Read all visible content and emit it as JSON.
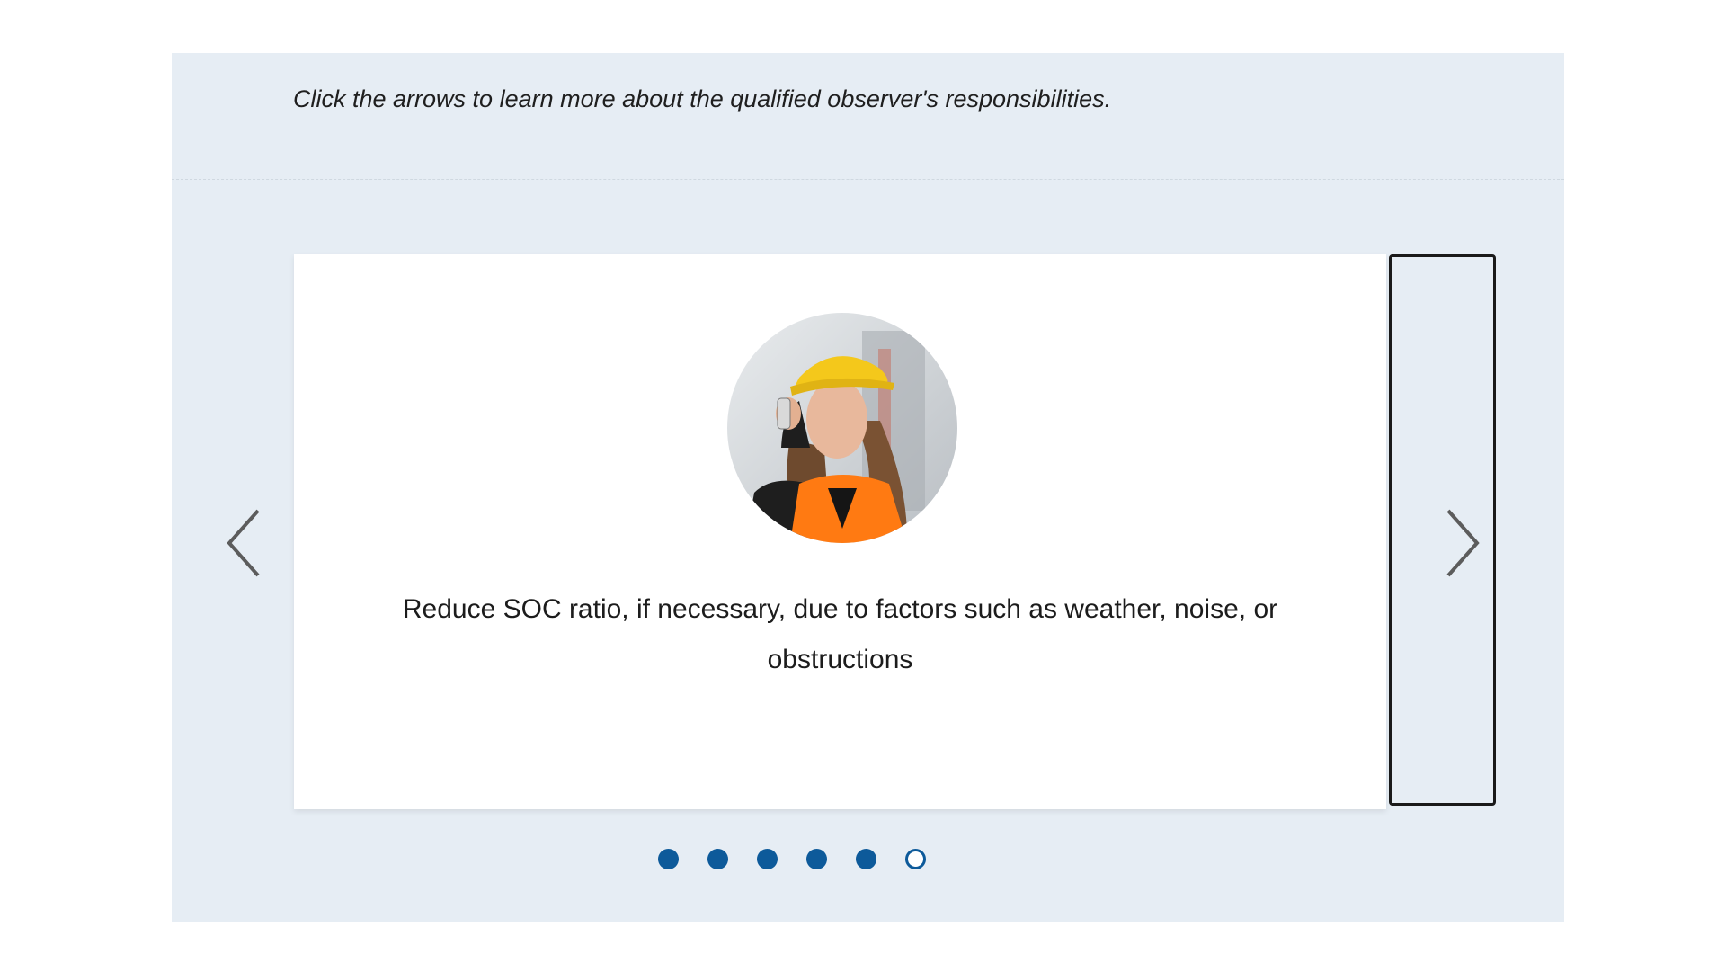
{
  "instruction": "Click the arrows to learn more about the qualified observer's responsibilities.",
  "slide": {
    "image": "worker-photo",
    "text": "Reduce SOC ratio, if necessary, due to factors such as weather, noise, or obstructions"
  },
  "icons": {
    "prev": "chevron-left-icon",
    "next": "chevron-right-icon"
  },
  "pagination": {
    "total": 6,
    "current": 6
  },
  "colors": {
    "panel_background": "#e6edf4",
    "dot": "#0d5a9a",
    "vest": "#ff7a12",
    "hardhat": "#f4c81b"
  }
}
